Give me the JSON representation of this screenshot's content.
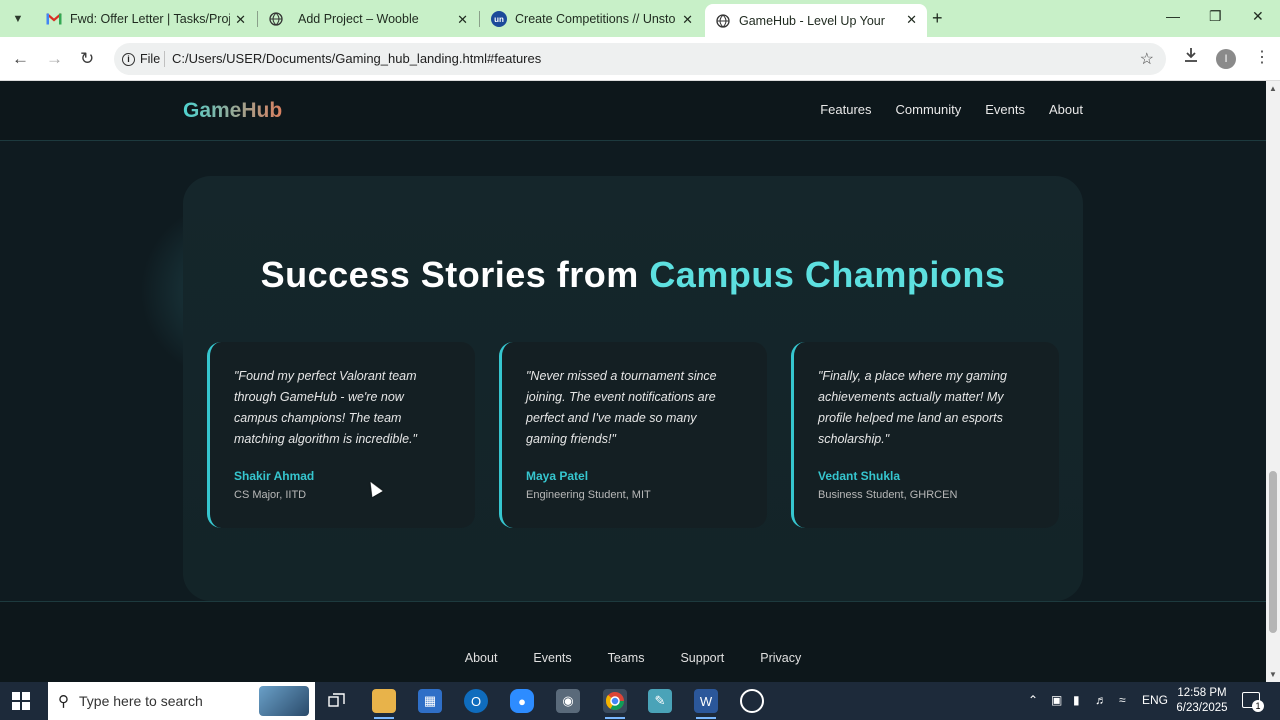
{
  "browser": {
    "tabs": [
      {
        "title": "Fwd: Offer Letter | Tasks/Project",
        "favicon": "gmail-icon",
        "active": false
      },
      {
        "title": "Add Project – Wooble",
        "favicon": "globe-icon",
        "active": false
      },
      {
        "title": "Create Competitions // Unstop",
        "favicon": "unstop-icon",
        "active": false
      },
      {
        "title": "GameHub - Level Up Your Cam",
        "favicon": "globe-icon",
        "active": true
      }
    ],
    "address": {
      "scheme_label": "File",
      "url": "C:/Users/USER/Documents/Gaming_hub_landing.html#features"
    },
    "profile_initial": "I"
  },
  "site": {
    "logo": "GameHub",
    "nav": [
      "Features",
      "Community",
      "Events",
      "About"
    ],
    "stories": {
      "title_main": "Success Stories from ",
      "title_accent": "Campus Champions",
      "cards": [
        {
          "quote": "\"Found my perfect Valorant team through GameHub - we're now campus champions! The team matching algorithm is incredible.\"",
          "author": "Shakir Ahmad",
          "role": "CS Major, IITD"
        },
        {
          "quote": "\"Never missed a tournament since joining. The event notifications are perfect and I've made so many gaming friends!\"",
          "author": "Maya Patel",
          "role": "Engineering Student, MIT"
        },
        {
          "quote": "\"Finally, a place where my gaming achievements actually matter! My profile helped me land an esports scholarship.\"",
          "author": "Vedant Shukla",
          "role": "Business Student, GHRCEN"
        }
      ]
    },
    "footer": [
      "About",
      "Events",
      "Teams",
      "Support",
      "Privacy"
    ]
  },
  "taskbar": {
    "search_placeholder": "Type here to search",
    "language": "ENG",
    "time": "12:58 PM",
    "date": "6/23/2025",
    "notification_count": "1"
  }
}
